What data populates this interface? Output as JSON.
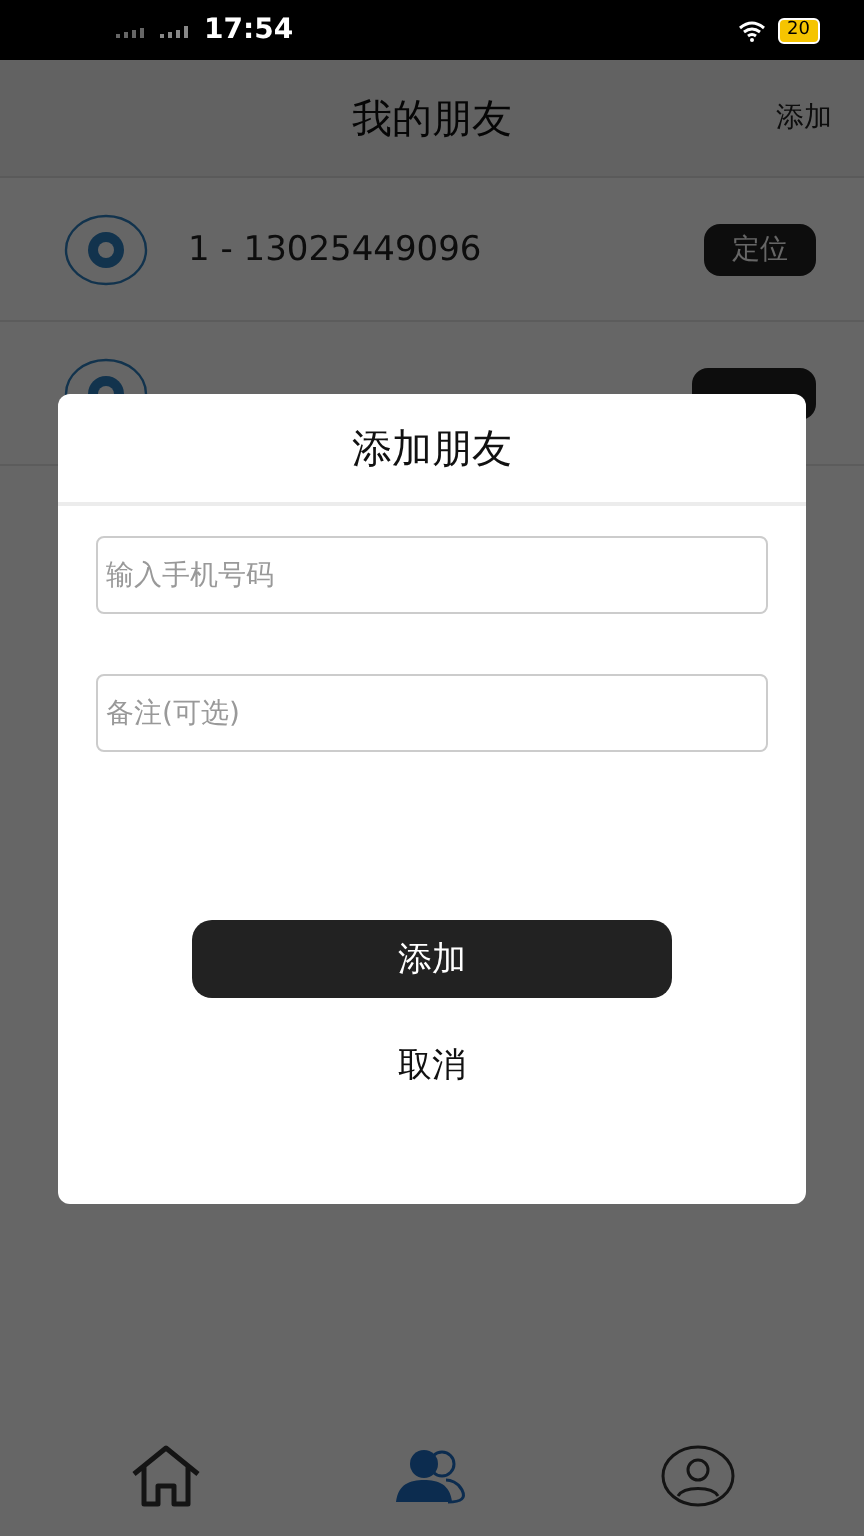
{
  "status_bar": {
    "time": "17:54",
    "battery": "20"
  },
  "header": {
    "title": "我的朋友",
    "action": "添加"
  },
  "friends": [
    {
      "name": "1 - 13025449096",
      "button": "定位"
    },
    {
      "kind": "covered"
    }
  ],
  "dialog": {
    "title": "添加朋友",
    "fields": [
      {
        "placeholder": "输入手机号码"
      },
      {
        "placeholder": "备注(可选)"
      }
    ],
    "confirm": "添加",
    "cancel": "取消"
  },
  "tabs": [
    {
      "kind": "home",
      "selected": false
    },
    {
      "kind": "friends",
      "selected": true
    },
    {
      "kind": "profile",
      "selected": false
    }
  ]
}
